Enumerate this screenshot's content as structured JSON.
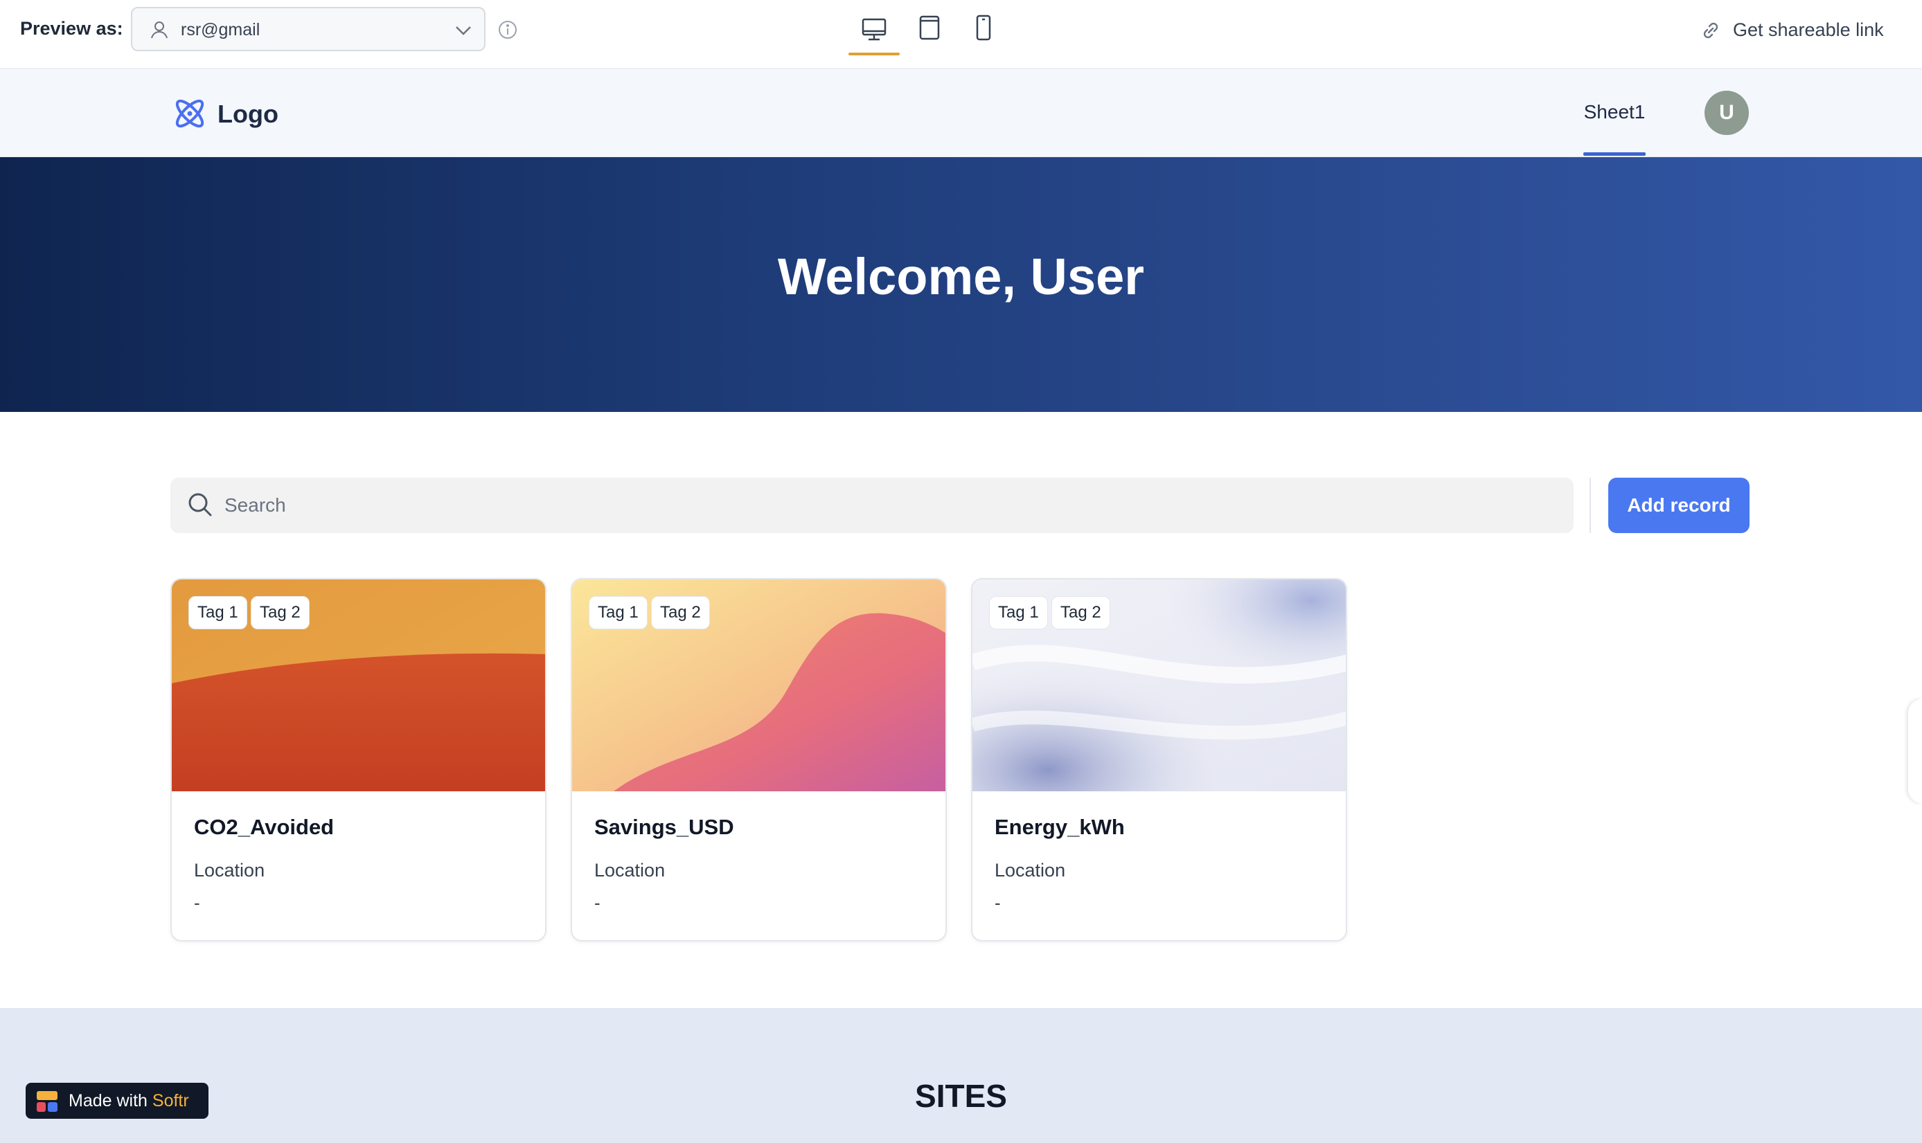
{
  "preview": {
    "label": "Preview as:",
    "user": "rsr@gmail",
    "share_label": "Get shareable link"
  },
  "header": {
    "logo_text": "Logo",
    "nav_item": "Sheet1",
    "avatar_initial": "U"
  },
  "hero": {
    "title": "Welcome, User"
  },
  "toolbar": {
    "search_placeholder": "Search",
    "add_label": "Add record"
  },
  "cards": [
    {
      "tags": [
        "Tag 1",
        "Tag 2"
      ],
      "title": "CO2_Avoided",
      "field_label": "Location",
      "field_value": "-"
    },
    {
      "tags": [
        "Tag 1",
        "Tag 2"
      ],
      "title": "Savings_USD",
      "field_label": "Location",
      "field_value": "-"
    },
    {
      "tags": [
        "Tag 1",
        "Tag 2"
      ],
      "title": "Energy_kWh",
      "field_label": "Location",
      "field_value": "-"
    }
  ],
  "sites": {
    "title": "SITES"
  },
  "badge": {
    "prefix": "Made with",
    "brand": "Softr"
  },
  "colors": {
    "accent": "#4a78f0",
    "nav_underline": "#3b63d4",
    "hero_start": "#0f2550",
    "hero_end": "#3358a8",
    "avatar": "#8d9b91",
    "active_device": "#e0a033"
  }
}
